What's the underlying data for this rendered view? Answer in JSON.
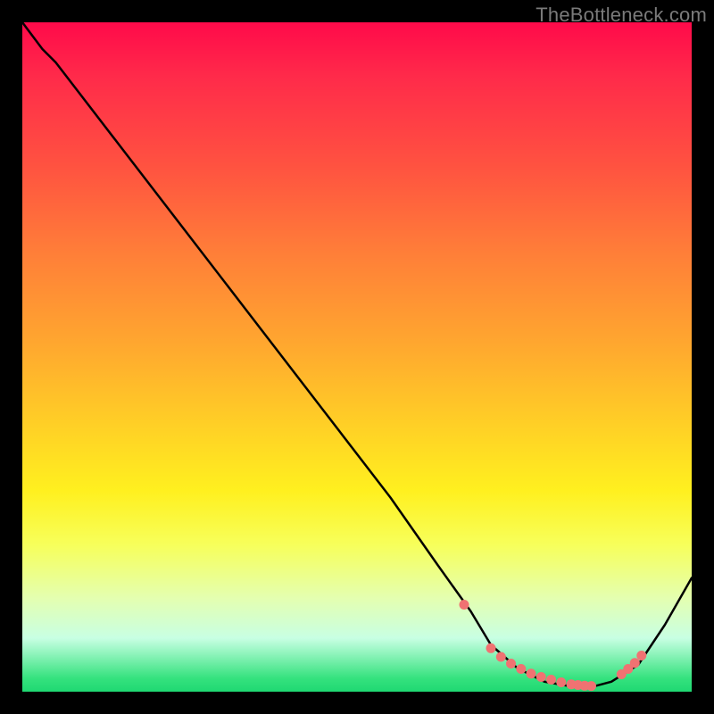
{
  "watermark": "TheBottleneck.com",
  "colors": {
    "frame": "#000000",
    "line": "#000000",
    "dots": "#f07272",
    "gradient_top": "#ff0a4a",
    "gradient_bottom": "#1fd872"
  },
  "chart_data": {
    "type": "line",
    "title": "",
    "xlabel": "",
    "ylabel": "",
    "xlim": [
      0,
      100
    ],
    "ylim": [
      0,
      100
    ],
    "grid": false,
    "legend_position": "none",
    "note": "Image has no axis tick labels; values are estimated from pixel positions as percentages of plot extent. y=0 at bottom, x=0 at left.",
    "series": [
      {
        "name": "curve",
        "x": [
          0,
          3,
          5,
          15,
          25,
          35,
          45,
          55,
          62,
          67,
          70,
          74,
          78,
          82,
          85,
          88,
          92,
          96,
          100
        ],
        "y": [
          100,
          96,
          94,
          81,
          68,
          55,
          42,
          29,
          19,
          12,
          7,
          3.5,
          1.5,
          0.8,
          0.7,
          1.5,
          4,
          10,
          17
        ]
      },
      {
        "name": "dots",
        "type": "scatter",
        "x": [
          66,
          70,
          71.5,
          73,
          74.5,
          76,
          77.5,
          79,
          80.5,
          82,
          83,
          84,
          85,
          89.5,
          90.5,
          91.5,
          92.5
        ],
        "y": [
          13,
          6.5,
          5.2,
          4.2,
          3.4,
          2.7,
          2.2,
          1.8,
          1.4,
          1.1,
          1.0,
          0.9,
          0.85,
          2.6,
          3.4,
          4.3,
          5.4
        ]
      }
    ]
  }
}
